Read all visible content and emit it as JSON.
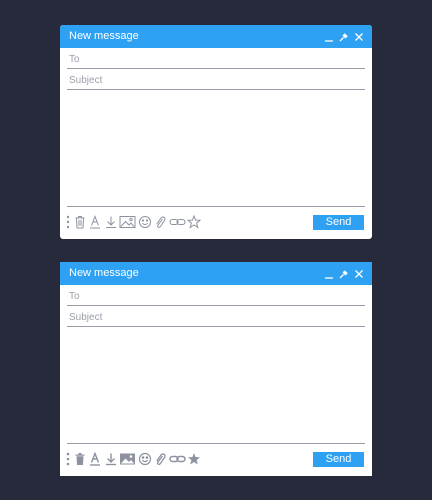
{
  "colors": {
    "background": "#262a3a",
    "accent": "#2ea1f3",
    "line": "#9aa0aa",
    "icon": "#8c92a0"
  },
  "windows": [
    {
      "title": "New message",
      "to_placeholder": "To",
      "subject_placeholder": "Subject",
      "send_label": "Send",
      "icon_style": "outline",
      "titlebar_icons": [
        "minimize-icon",
        "pin-icon",
        "close-icon"
      ],
      "toolbar_icons": [
        "more-icon",
        "trash-icon",
        "font-color-icon",
        "download-icon",
        "image-icon",
        "emoji-icon",
        "attach-icon",
        "link-icon",
        "star-icon"
      ]
    },
    {
      "title": "New message",
      "to_placeholder": "To",
      "subject_placeholder": "Subject",
      "send_label": "Send",
      "icon_style": "filled",
      "titlebar_icons": [
        "minimize-icon",
        "pin-icon",
        "close-icon"
      ],
      "toolbar_icons": [
        "more-icon",
        "trash-icon",
        "font-color-icon",
        "download-icon",
        "image-icon",
        "emoji-icon",
        "attach-icon",
        "link-icon",
        "star-icon"
      ]
    }
  ]
}
